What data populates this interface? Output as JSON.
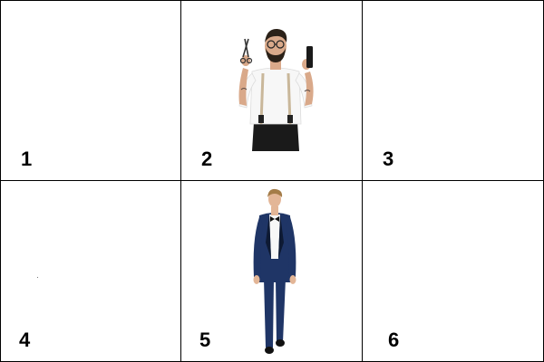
{
  "grid": {
    "cells": [
      {
        "number": "1",
        "content": "empty"
      },
      {
        "number": "2",
        "content": "barber-man-with-scissors-and-comb"
      },
      {
        "number": "3",
        "content": "empty"
      },
      {
        "number": "4",
        "content": "empty"
      },
      {
        "number": "5",
        "content": "man-in-navy-tuxedo"
      },
      {
        "number": "6",
        "content": "empty"
      }
    ]
  },
  "colors": {
    "border": "#000000",
    "background": "#ffffff",
    "number_text": "#000000",
    "tuxedo": "#1f3566",
    "shirt": "#f7f7f7",
    "trousers": "#1a1a1a",
    "suspenders": "#c9b79a",
    "skin": "#d9a98a",
    "hair": "#2b2118",
    "blond_hair": "#a47c48"
  }
}
